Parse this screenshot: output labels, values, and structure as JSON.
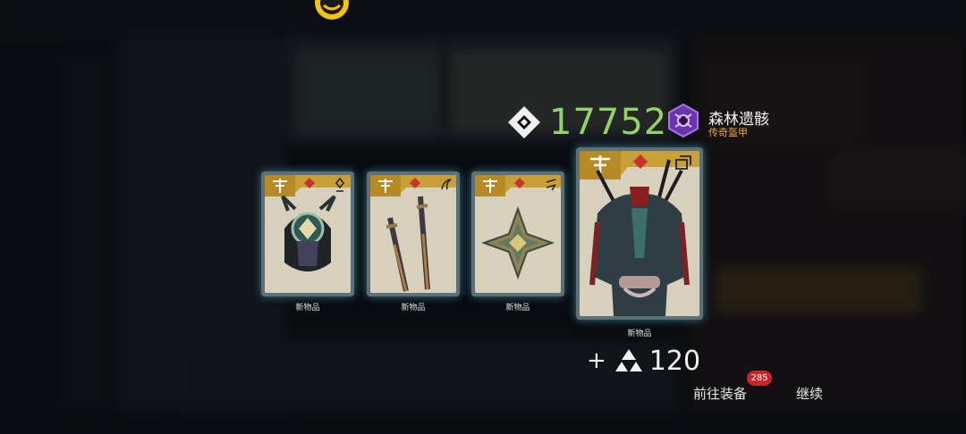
{
  "score": {
    "value": "17752",
    "color": "#8fd36a"
  },
  "item": {
    "name": "森林遗骸",
    "type": "传奇盔甲",
    "rarity_color": "#7a3fc0"
  },
  "cards": [
    {
      "label": "新物品",
      "art": "helmet-art",
      "class_icon": "rank-icon"
    },
    {
      "label": "新物品",
      "art": "swords-art",
      "class_icon": "claw-icon"
    },
    {
      "label": "新物品",
      "art": "shuriken-art",
      "class_icon": "arrows-icon"
    },
    {
      "label": "新物品",
      "art": "armor-art",
      "class_icon": "layers-icon"
    }
  ],
  "reward": {
    "plus": "+",
    "value": "120"
  },
  "buttons": {
    "equip": "前往装备",
    "equip_badge": "285",
    "continue": "继续"
  }
}
